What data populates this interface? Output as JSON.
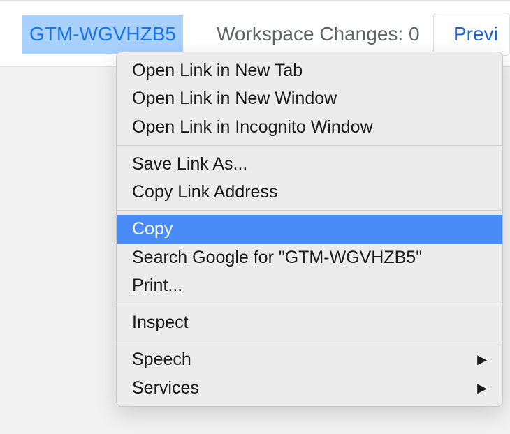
{
  "toolbar": {
    "gtm_id": "GTM-WGVHZB5",
    "workspace_changes_label": "Workspace Changes: 0",
    "preview_label": "Previ"
  },
  "context_menu": {
    "items": [
      {
        "label": "Open Link in New Tab",
        "highlighted": false,
        "hasSubmenu": false
      },
      {
        "label": "Open Link in New Window",
        "highlighted": false,
        "hasSubmenu": false
      },
      {
        "label": "Open Link in Incognito Window",
        "highlighted": false,
        "hasSubmenu": false
      }
    ],
    "items2": [
      {
        "label": "Save Link As...",
        "highlighted": false,
        "hasSubmenu": false
      },
      {
        "label": "Copy Link Address",
        "highlighted": false,
        "hasSubmenu": false
      }
    ],
    "items3": [
      {
        "label": "Copy",
        "highlighted": true,
        "hasSubmenu": false
      },
      {
        "label": "Search Google for \"GTM-WGVHZB5\"",
        "highlighted": false,
        "hasSubmenu": false
      },
      {
        "label": "Print...",
        "highlighted": false,
        "hasSubmenu": false
      }
    ],
    "items4": [
      {
        "label": "Inspect",
        "highlighted": false,
        "hasSubmenu": false
      }
    ],
    "items5": [
      {
        "label": "Speech",
        "highlighted": false,
        "hasSubmenu": true
      },
      {
        "label": "Services",
        "highlighted": false,
        "hasSubmenu": true
      }
    ]
  }
}
